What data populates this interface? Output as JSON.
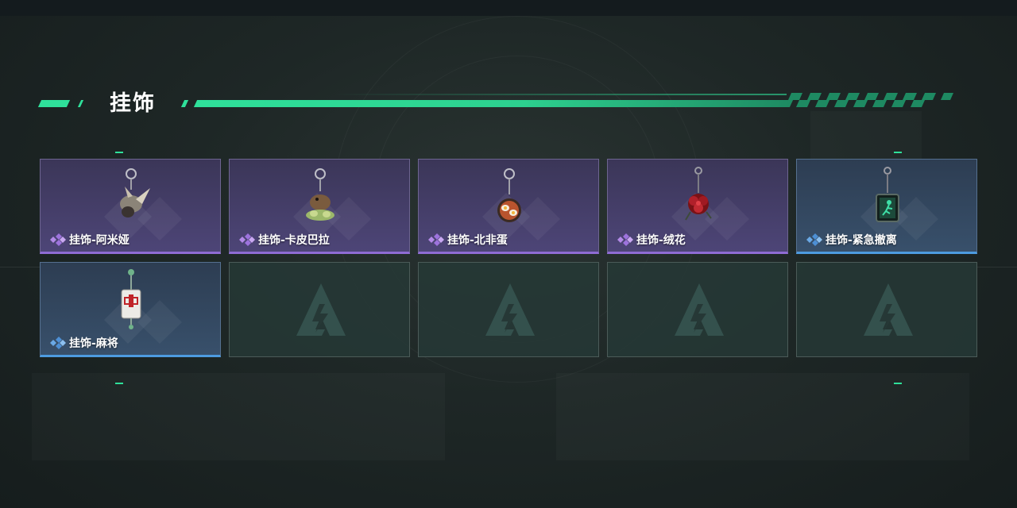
{
  "section": {
    "title": "挂饰"
  },
  "colors": {
    "accent_green": "#2fe09a",
    "rarity_purple": "#8f6cd4",
    "rarity_blue": "#4d9be0"
  },
  "items": [
    {
      "label": "挂饰-阿米娅",
      "rarity": "purple",
      "icon": "amiya-charm-icon"
    },
    {
      "label": "挂饰-卡皮巴拉",
      "rarity": "purple",
      "icon": "capybara-charm-icon"
    },
    {
      "label": "挂饰-北非蛋",
      "rarity": "purple",
      "icon": "shakshuka-charm-icon"
    },
    {
      "label": "挂饰-绒花",
      "rarity": "purple",
      "icon": "velvet-flower-charm-icon"
    },
    {
      "label": "挂饰-紧急撤离",
      "rarity": "blue",
      "icon": "emergency-exit-charm-icon"
    },
    {
      "label": "挂饰-麻将",
      "rarity": "blue",
      "icon": "mahjong-charm-icon"
    }
  ],
  "empty_slots": {
    "count": 4,
    "icon": "game-logo-icon"
  }
}
